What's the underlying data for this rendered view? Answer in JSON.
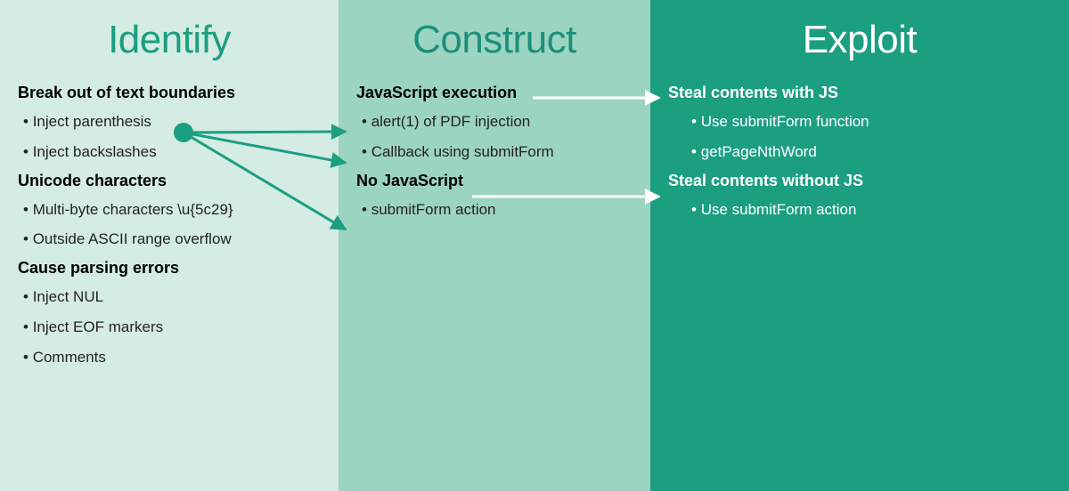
{
  "columns": {
    "identify": {
      "title": "Identify",
      "sections": [
        {
          "title": "Break out of text boundaries",
          "items": [
            "Inject parenthesis",
            "Inject backslashes"
          ]
        },
        {
          "title": "Unicode characters",
          "items": [
            "Multi-byte characters \\u{5c29}",
            "Outside ASCII range overflow"
          ]
        },
        {
          "title": "Cause parsing errors",
          "items": [
            "Inject NUL",
            "Inject EOF markers",
            "Comments"
          ]
        }
      ]
    },
    "construct": {
      "title": "Construct",
      "sections": [
        {
          "title": "JavaScript execution",
          "items": [
            "alert(1) of PDF injection",
            "Callback using submitForm"
          ]
        },
        {
          "title": "No JavaScript",
          "items": [
            "submitForm action"
          ]
        }
      ]
    },
    "exploit": {
      "title": "Exploit",
      "sections": [
        {
          "title": "Steal contents with JS",
          "items": [
            "Use submitForm function",
            "getPageNthWord"
          ]
        },
        {
          "title": "Steal contents without JS",
          "items": [
            "Use submitForm action"
          ]
        }
      ]
    }
  },
  "arrows": [
    {
      "from": "identify.inject-parenthesis",
      "to": "construct.alert1",
      "color": "#1c9e81"
    },
    {
      "from": "identify.inject-parenthesis",
      "to": "construct.callback",
      "color": "#1c9e81"
    },
    {
      "from": "identify.inject-parenthesis",
      "to": "construct.submitform-action",
      "color": "#1c9e81"
    },
    {
      "from": "construct.js-execution",
      "to": "exploit.steal-with-js",
      "color": "#ffffff"
    },
    {
      "from": "construct.no-js",
      "to": "exploit.steal-without-js",
      "color": "#ffffff"
    }
  ]
}
